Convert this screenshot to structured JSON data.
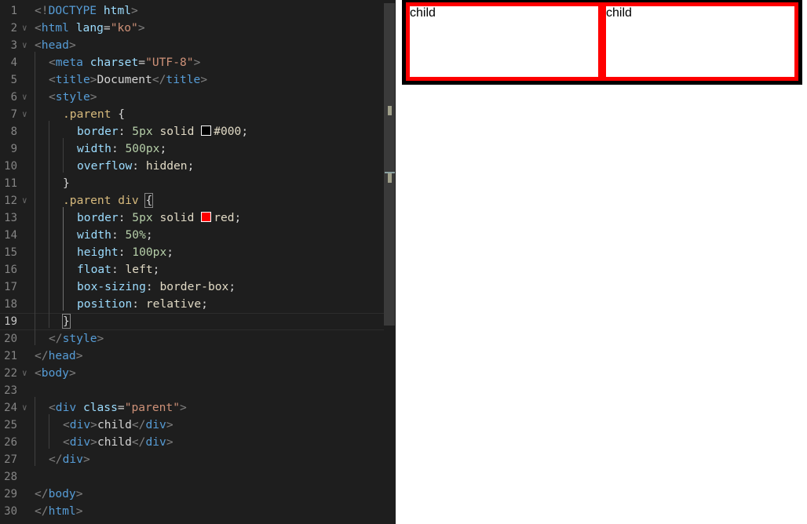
{
  "editor": {
    "current_line": 19,
    "lines": [
      {
        "n": "1",
        "fold": false,
        "indent": 0,
        "tokens": [
          [
            "br",
            "<!"
          ],
          [
            "tag",
            "DOCTYPE"
          ],
          [
            "txt",
            " "
          ],
          [
            "attr",
            "html"
          ],
          [
            "br",
            ">"
          ]
        ]
      },
      {
        "n": "2",
        "fold": true,
        "indent": 0,
        "tokens": [
          [
            "br",
            "<"
          ],
          [
            "tag",
            "html"
          ],
          [
            "txt",
            " "
          ],
          [
            "attr",
            "lang"
          ],
          [
            "txt",
            "="
          ],
          [
            "str",
            "\"ko\""
          ],
          [
            "br",
            ">"
          ]
        ]
      },
      {
        "n": "3",
        "fold": true,
        "indent": 0,
        "tokens": [
          [
            "br",
            "<"
          ],
          [
            "tag",
            "head"
          ],
          [
            "br",
            ">"
          ]
        ]
      },
      {
        "n": "4",
        "fold": false,
        "indent": 1,
        "tokens": [
          [
            "br",
            "<"
          ],
          [
            "tag",
            "meta"
          ],
          [
            "txt",
            " "
          ],
          [
            "attr",
            "charset"
          ],
          [
            "txt",
            "="
          ],
          [
            "str",
            "\"UTF-8\""
          ],
          [
            "br",
            ">"
          ]
        ]
      },
      {
        "n": "5",
        "fold": false,
        "indent": 1,
        "tokens": [
          [
            "br",
            "<"
          ],
          [
            "tag",
            "title"
          ],
          [
            "br",
            ">"
          ],
          [
            "txt",
            "Document"
          ],
          [
            "br",
            "</"
          ],
          [
            "tag",
            "title"
          ],
          [
            "br",
            ">"
          ]
        ]
      },
      {
        "n": "6",
        "fold": true,
        "indent": 1,
        "tokens": [
          [
            "br",
            "<"
          ],
          [
            "tag",
            "style"
          ],
          [
            "br",
            ">"
          ]
        ]
      },
      {
        "n": "7",
        "fold": true,
        "indent": 2,
        "tokens": [
          [
            "sel",
            ".parent"
          ],
          [
            "txt",
            " {"
          ]
        ]
      },
      {
        "n": "8",
        "fold": false,
        "indent": 3,
        "tokens": [
          [
            "prop",
            "border"
          ],
          [
            "txt",
            ": "
          ],
          [
            "num",
            "5px"
          ],
          [
            "txt",
            " "
          ],
          [
            "val",
            "solid"
          ],
          [
            "txt",
            " "
          ],
          [
            "swatch",
            "#000000"
          ],
          [
            "val",
            "#000"
          ],
          [
            "txt",
            ";"
          ]
        ]
      },
      {
        "n": "9",
        "fold": false,
        "indent": 3,
        "tokens": [
          [
            "prop",
            "width"
          ],
          [
            "txt",
            ": "
          ],
          [
            "num",
            "500px"
          ],
          [
            "txt",
            ";"
          ]
        ]
      },
      {
        "n": "10",
        "fold": false,
        "indent": 3,
        "tokens": [
          [
            "prop",
            "overflow"
          ],
          [
            "txt",
            ": "
          ],
          [
            "val",
            "hidden"
          ],
          [
            "txt",
            ";"
          ]
        ]
      },
      {
        "n": "11",
        "fold": false,
        "indent": 2,
        "tokens": [
          [
            "txt",
            "}"
          ]
        ]
      },
      {
        "n": "12",
        "fold": true,
        "indent": 2,
        "tokens": [
          [
            "sel",
            ".parent div"
          ],
          [
            "txt",
            " "
          ],
          [
            "match",
            "{"
          ]
        ]
      },
      {
        "n": "13",
        "fold": false,
        "indent": 3,
        "tokens": [
          [
            "prop",
            "border"
          ],
          [
            "txt",
            ": "
          ],
          [
            "num",
            "5px"
          ],
          [
            "txt",
            " "
          ],
          [
            "val",
            "solid"
          ],
          [
            "txt",
            " "
          ],
          [
            "swatch",
            "#ff0000"
          ],
          [
            "val",
            "red"
          ],
          [
            "txt",
            ";"
          ]
        ]
      },
      {
        "n": "14",
        "fold": false,
        "indent": 3,
        "tokens": [
          [
            "prop",
            "width"
          ],
          [
            "txt",
            ": "
          ],
          [
            "num",
            "50%"
          ],
          [
            "txt",
            ";"
          ]
        ]
      },
      {
        "n": "15",
        "fold": false,
        "indent": 3,
        "tokens": [
          [
            "prop",
            "height"
          ],
          [
            "txt",
            ": "
          ],
          [
            "num",
            "100px"
          ],
          [
            "txt",
            ";"
          ]
        ]
      },
      {
        "n": "16",
        "fold": false,
        "indent": 3,
        "tokens": [
          [
            "prop",
            "float"
          ],
          [
            "txt",
            ": "
          ],
          [
            "val",
            "left"
          ],
          [
            "txt",
            ";"
          ]
        ]
      },
      {
        "n": "17",
        "fold": false,
        "indent": 3,
        "tokens": [
          [
            "prop",
            "box-sizing"
          ],
          [
            "txt",
            ": "
          ],
          [
            "val",
            "border-box"
          ],
          [
            "txt",
            ";"
          ]
        ]
      },
      {
        "n": "18",
        "fold": false,
        "indent": 3,
        "tokens": [
          [
            "prop",
            "position"
          ],
          [
            "txt",
            ": "
          ],
          [
            "val",
            "relative"
          ],
          [
            "txt",
            ";"
          ]
        ]
      },
      {
        "n": "19",
        "fold": false,
        "indent": 2,
        "tokens": [
          [
            "match",
            "}"
          ]
        ]
      },
      {
        "n": "20",
        "fold": false,
        "indent": 1,
        "tokens": [
          [
            "br",
            "</"
          ],
          [
            "tag",
            "style"
          ],
          [
            "br",
            ">"
          ]
        ]
      },
      {
        "n": "21",
        "fold": false,
        "indent": 0,
        "tokens": [
          [
            "br",
            "</"
          ],
          [
            "tag",
            "head"
          ],
          [
            "br",
            ">"
          ]
        ]
      },
      {
        "n": "22",
        "fold": true,
        "indent": 0,
        "tokens": [
          [
            "br",
            "<"
          ],
          [
            "tag",
            "body"
          ],
          [
            "br",
            ">"
          ]
        ]
      },
      {
        "n": "23",
        "fold": false,
        "indent": 0,
        "tokens": []
      },
      {
        "n": "24",
        "fold": true,
        "indent": 1,
        "tokens": [
          [
            "br",
            "<"
          ],
          [
            "tag",
            "div"
          ],
          [
            "txt",
            " "
          ],
          [
            "attr",
            "class"
          ],
          [
            "txt",
            "="
          ],
          [
            "str",
            "\"parent\""
          ],
          [
            "br",
            ">"
          ]
        ]
      },
      {
        "n": "25",
        "fold": false,
        "indent": 2,
        "tokens": [
          [
            "br",
            "<"
          ],
          [
            "tag",
            "div"
          ],
          [
            "br",
            ">"
          ],
          [
            "txt",
            "child"
          ],
          [
            "br",
            "</"
          ],
          [
            "tag",
            "div"
          ],
          [
            "br",
            ">"
          ]
        ]
      },
      {
        "n": "26",
        "fold": false,
        "indent": 2,
        "tokens": [
          [
            "br",
            "<"
          ],
          [
            "tag",
            "div"
          ],
          [
            "br",
            ">"
          ],
          [
            "txt",
            "child"
          ],
          [
            "br",
            "</"
          ],
          [
            "tag",
            "div"
          ],
          [
            "br",
            ">"
          ]
        ]
      },
      {
        "n": "27",
        "fold": false,
        "indent": 1,
        "tokens": [
          [
            "br",
            "</"
          ],
          [
            "tag",
            "div"
          ],
          [
            "br",
            ">"
          ]
        ]
      },
      {
        "n": "28",
        "fold": false,
        "indent": 0,
        "tokens": []
      },
      {
        "n": "29",
        "fold": false,
        "indent": 0,
        "tokens": [
          [
            "br",
            "</"
          ],
          [
            "tag",
            "body"
          ],
          [
            "br",
            ">"
          ]
        ]
      },
      {
        "n": "30",
        "fold": false,
        "indent": 0,
        "tokens": [
          [
            "br",
            "</"
          ],
          [
            "tag",
            "html"
          ],
          [
            "br",
            ">"
          ]
        ]
      }
    ]
  },
  "preview": {
    "children": [
      "child",
      "child"
    ]
  }
}
